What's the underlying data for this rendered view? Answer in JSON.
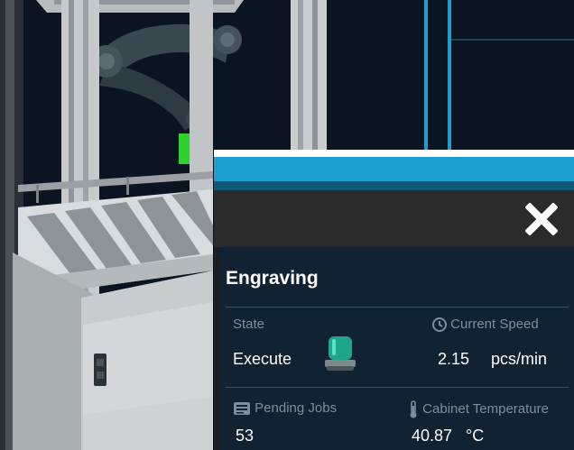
{
  "machine": {
    "title": "Engraving",
    "close_icon": "close-icon"
  },
  "state": {
    "label": "State",
    "value": "Execute",
    "indicator_icon": "beacon-light-icon",
    "indicator_color": "#1fa58a"
  },
  "speed": {
    "label": "Current Speed",
    "icon": "clock-icon",
    "value": "2.15",
    "unit": "pcs/min"
  },
  "pending_jobs": {
    "label": "Pending Jobs",
    "icon": "list-icon",
    "value": "53"
  },
  "cabinet_temperature": {
    "label": "Cabinet Temperature",
    "icon": "thermometer-icon",
    "value": "40.87",
    "unit": "°C"
  },
  "colors": {
    "accent": "#1a9fd0",
    "panel_body": "#112233",
    "sensor_green": "#2fd12f"
  }
}
